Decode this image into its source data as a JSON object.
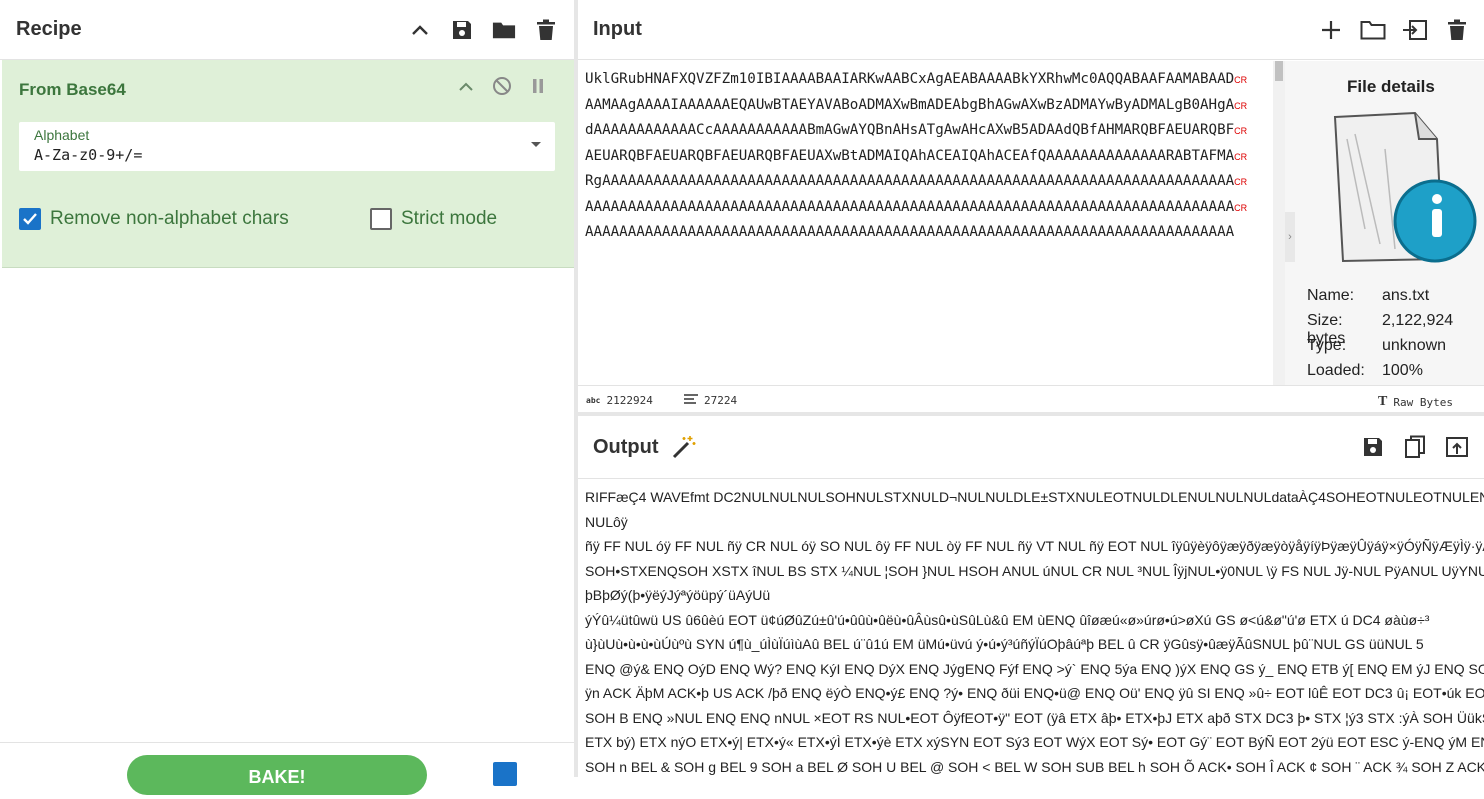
{
  "recipe": {
    "title": "Recipe",
    "operation": {
      "name": "From Base64",
      "alphabet_label": "Alphabet",
      "alphabet_value": "A-Za-z0-9+/=",
      "remove_non_alphabet_label": "Remove non-alphabet chars",
      "strict_mode_label": "Strict mode"
    }
  },
  "input": {
    "title": "Input",
    "lines": [
      "UklGRubHNAFXQVZFZm10IBIAAAABAAIARKwAABCxAgAEABAAAABkYXRhwMc0AQQABAAFAAMABAAD",
      "AAMAAgAAAAIAAAAAAEQAUwBTAEYAVABoADMAXwBmADEAbgBhAGwAXwBzADMAYwByADMALgB0AHgA",
      "dAAAAAAAAAAAACcAAAAAAAAAAABmAGwAYQBnAHsATgAwAHcAXwB5ADAAdQBfAHMARQBFAEUARQBF",
      "AEUARQBFAEUARQBFAEUARQBFAEUAXwBtADMAIQAhACEAIQAhACEAfQAAAAAAAAAAAAAARABTAFMA",
      "RgAAAAAAAAAAAAAAAAAAAAAAAAAAAAAAAAAAAAAAAAAAAAAAAAAAAAAAAAAAAAAAAAAAAAAAAAAA",
      "AAAAAAAAAAAAAAAAAAAAAAAAAAAAAAAAAAAAAAAAAAAAAAAAAAAAAAAAAAAAAAAAAAAAAAAAAAAA",
      "AAAAAAAAAAAAAAAAAAAAAAAAAAAAAAAAAAAAAAAAAAAAAAAAAAAAAAAAAAAAAAAAAAAAAAAAAAAA"
    ],
    "cr_marker": "CR",
    "status": {
      "length": "2122924",
      "lines": "27224",
      "format": "Raw Bytes"
    }
  },
  "file_details": {
    "title": "File details",
    "name_label": "Name:",
    "name_value": "ans.txt",
    "size_label": "Size:",
    "size_value": "2,122,924 bytes",
    "type_label": "Type:",
    "type_value": "unknown",
    "loaded_label": "Loaded:",
    "loaded_value": "100%"
  },
  "output": {
    "title": "Output",
    "lines": [
      "RIFFæÇ4 WAVEfmt  DC2NULNULNULSOHNULSTXNULD¬NULNULDLE±STXNULEOTNULDLENULNULNULdataÀÇ4SOHEOTNULEOTNULENQNULETXNULEOTNULETXNULETXNULSTXNUL",
      "NULôÿ",
      "ñÿ FF NUL óÿ FF NUL ñÿ CR NUL óÿ SO NUL ôÿ FF NUL òÿ FF NUL ñÿ VT NUL ñÿ EOT NUL îÿûÿèÿôÿæÿðÿæÿòÿåÿíÿÞÿæÿÛÿáÿ×ÿÓÿÑÿÆÿÌÿ·ÿÁÿ¨ÿºÿ",
      "SOH•STXENQSOH XSTX îNUL BS STX ¼NUL ¦SOH }NUL HSOH ANUL úNUL CR NUL ³NUL ÎÿjNUL•ÿ0NUL \\ÿ FS NUL Jÿ-NUL PÿANUL UÿYNUL aÿ{NUL uÿ¡NUL•ÿÉNUL•ÿÿNUL ¼ÿè",
      "þBþØý(þ•ÿëýJýªýöüpý´üAýUü",
      "ýÝû¼ütûwü US û6ûèú EOT ü¢úØûZú±û'ú•ûûù•ûëù•ûÂùsû•ùSûLù&û EM ùENQ ûîøæú«ø»úrø•ú>øXú GS ø<ú&ø\"ú'ø ETX ú DC4 øàùø÷³",
      "ù}ùUù•ù•ù•ùÚùºù SYN ú¶ù_úÌùÏúìùAû BEL ú¨û1ú EM üMú•üvú ý•ú•ý³úñýÏúOþâúªþ BEL û CR ÿGûsÿ•ûæÿÃûSNUL þû¨NUL GS üüNUL 5",
      "ENQ @ý& ENQ OýD ENQ Wý? ENQ KýI ENQ DýX ENQ JýgENQ Fýf ENQ >ý` ENQ 5ýa ENQ )ýX ENQ GS ý_ ENQ ETB ý[ ENQ EM ýJ ENQ SOH ý3 ENQ äü ENQ Éü DC3 ENQ Àü ETX ENQ ³üø EOT",
      "ÿn ACK ÄþM ACK•þ US ACK /þð ENQ ëýÒ ENQ•ý£ ENQ ?ý• ENQ ðüi ENQ•ü@ ENQ Oü' ENQ ÿû SI ENQ »û÷ EOT lûÊ EOT DC3 û¡ EOT•úk EOT US ú& EOT ¯ùÔ ETX TùÇ ETX CAN ù¥",
      "SOH B ENQ »NUL ENQ ENQ nNUL ×EOT RS NUL•EOT ÔÿfEOT•ÿ\" EOT (ÿâ ETX âþ• ETX•þJ ETX aþð STX DC3 þ• STX ¦ý3 STX :ýÀ SOH ÜükSOH•ü DC2 SOH 6üÇNUL ëû•NUL•û9NUL J",
      "ETX bý) ETX nýO ETX•ý| ETX•ý« ETX•ýÌ ETX•ýè ETX xýSYN EOT Sý3 EOT WýX EOT Sý• EOT Gý¨ EOT BýÑ EOT 2ýü EOT ESC ý-ENQ ýM ENQ ESC ýq ENQ $ý• ENQ GS ý¥ ENQ ý",
      "SOH n BEL & SOH g BEL 9 SOH a BEL Ø SOH U BEL @ SOH < BEL W SOH SUB BEL h SOH Õ ACK• SOH Î ACK ¢ SOH ¨ ACK ¾ SOH Z ACK Ü SOH H ACK ñ SOH CR ACK EOT STX , ENQ DC2 STX U ENQ CR STX Õ EOT DC4 STX•EO"
    ]
  },
  "bake": {
    "label": "BAKE!"
  }
}
